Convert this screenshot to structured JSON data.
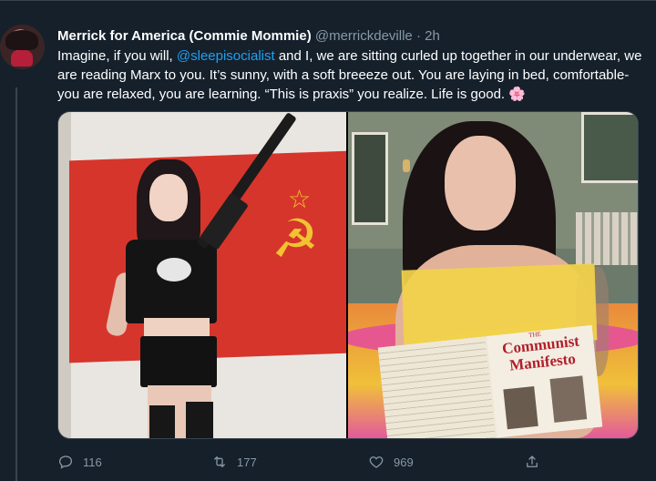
{
  "tweet": {
    "display_name": "Merrick for America (Commie Mommie)",
    "handle": "@merrickdeville",
    "separator": "·",
    "time": "2h",
    "text_before_mention": "Imagine, if you will, ",
    "mention": "@sleepisocialist",
    "text_after_mention": " and I, we are sitting curled up together in our underwear, we are reading Marx to you. It’s sunny, with a soft breeeze out. You are laying in bed, comfortable- you are relaxed, you are learning. “This is praxis” you realize. Life is good. ",
    "emoji": "🌸"
  },
  "media": {
    "book_title": "Communist Manifesto",
    "book_the": "THE"
  },
  "actions": {
    "reply_count": "116",
    "retweet_count": "177",
    "like_count": "969"
  },
  "colors": {
    "background": "#15202b",
    "text_secondary": "#8899a6",
    "link": "#1da1f2",
    "border": "#38444d"
  }
}
